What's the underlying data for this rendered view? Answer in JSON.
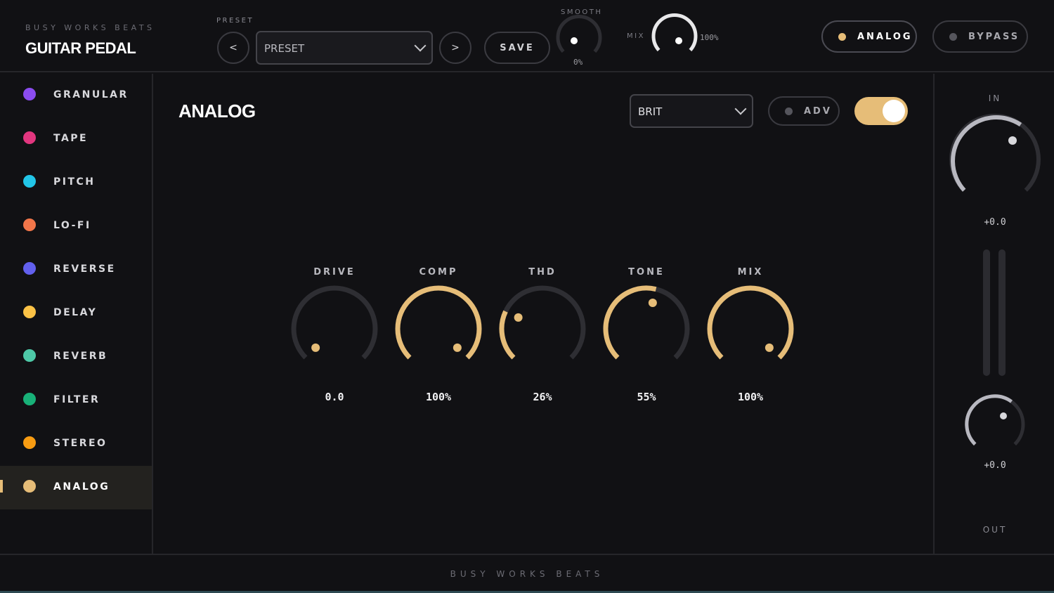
{
  "header": {
    "brand_subtitle": "BUSY WORKS BEATS",
    "brand_title": "GUITAR PEDAL",
    "preset_label": "PRESET",
    "prev_label": "<",
    "preset_value": "PRESET",
    "next_label": ">",
    "save_label": "SAVE",
    "smooth_label": "SMOOTH",
    "smooth_value": "0%",
    "mix_label": "MIX",
    "mix_value": "100%",
    "analog_label": "ANALOG",
    "bypass_label": "BYPASS"
  },
  "sidebar": {
    "items": [
      {
        "label": "GRANULAR",
        "color": "#8b4cf0",
        "active": false
      },
      {
        "label": "TAPE",
        "color": "#e2367f",
        "active": false
      },
      {
        "label": "PITCH",
        "color": "#22c6e8",
        "active": false
      },
      {
        "label": "LO-FI",
        "color": "#f2764a",
        "active": false
      },
      {
        "label": "REVERSE",
        "color": "#6260ee",
        "active": false
      },
      {
        "label": "DELAY",
        "color": "#fbc246",
        "active": false
      },
      {
        "label": "REVERB",
        "color": "#4ec9a8",
        "active": false
      },
      {
        "label": "FILTER",
        "color": "#18b178",
        "active": false
      },
      {
        "label": "STEREO",
        "color": "#f89c12",
        "active": false
      },
      {
        "label": "ANALOG",
        "color": "#e6bd78",
        "active": true
      }
    ]
  },
  "main": {
    "title": "ANALOG",
    "mode_select": "BRIT",
    "adv_label": "ADV",
    "enabled": true,
    "knobs": [
      {
        "label": "DRIVE",
        "value": "0.0",
        "fraction": 0.0
      },
      {
        "label": "COMP",
        "value": "100%",
        "fraction": 1.0
      },
      {
        "label": "THD",
        "value": "26%",
        "fraction": 0.26
      },
      {
        "label": "TONE",
        "value": "55%",
        "fraction": 0.55
      },
      {
        "label": "MIX",
        "value": "100%",
        "fraction": 1.0
      }
    ]
  },
  "right_panel": {
    "in_label": "IN",
    "in_value": "+0.0",
    "out_value": "+0.0",
    "out_label": "OUT"
  },
  "footer": {
    "text": "BUSY WORKS BEATS"
  },
  "colors": {
    "accent": "#e6bd78",
    "background": "#111114",
    "track": "#2e2e33"
  }
}
